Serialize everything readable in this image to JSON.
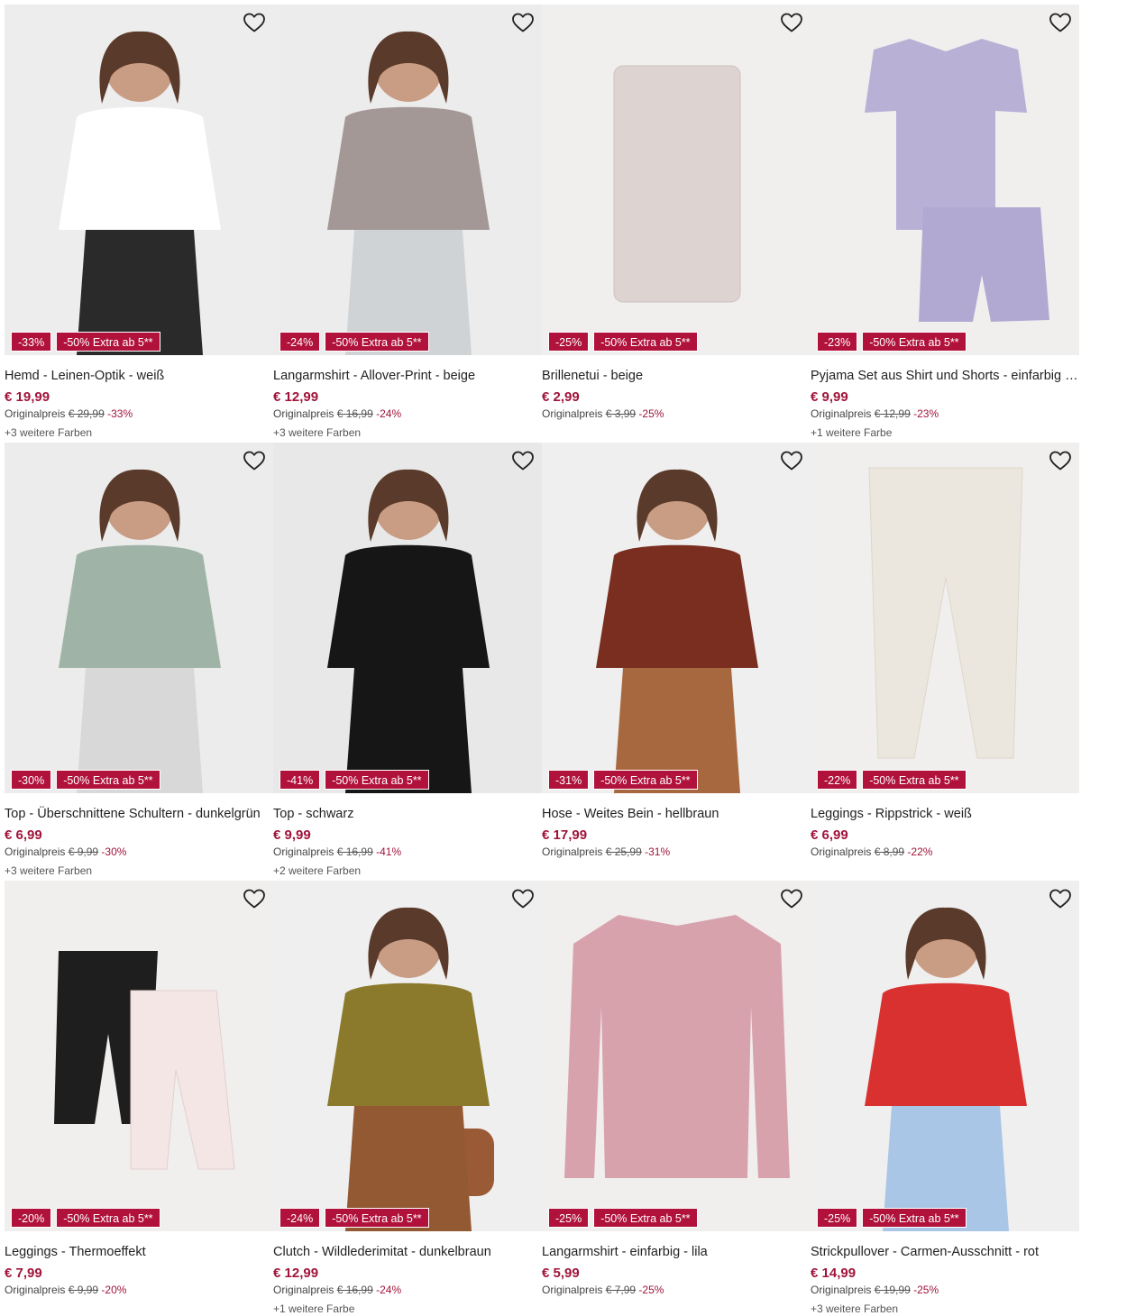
{
  "labels": {
    "originalprice": "Originalpreis"
  },
  "products": [
    {
      "title": "Hemd - Leinen-Optik - weiß",
      "price": "€ 19,99",
      "orig": "€ 29,99",
      "pct": "-33%",
      "badge": "-33%",
      "extra": "-50% Extra ab 5**",
      "colors": "+3 weitere Farben",
      "img": "man-white-shirt",
      "c1": "#ffffff",
      "c2": "#2a2a2a",
      "bg": "#ededed"
    },
    {
      "title": "Langarmshirt - Allover-Print - beige",
      "price": "€ 12,99",
      "orig": "€ 16,99",
      "pct": "-24%",
      "badge": "-24%",
      "extra": "-50% Extra ab 5**",
      "colors": "+3 weitere Farben",
      "img": "woman-print-shirt",
      "c1": "#a39896",
      "c2": "#cfd3d6",
      "bg": "#ececec"
    },
    {
      "title": "Brillenetui - beige",
      "price": "€ 2,99",
      "orig": "€ 3,99",
      "pct": "-25%",
      "badge": "-25%",
      "extra": "-50% Extra ab 5**",
      "colors": "",
      "img": "glasses-case",
      "c1": "#ddd3d0",
      "c2": "#ddd3d0",
      "bg": "#f0efee"
    },
    {
      "title": "Pyjama Set aus Shirt und Shorts - einfarbig - lila",
      "price": "€ 9,99",
      "orig": "€ 12,99",
      "pct": "-23%",
      "badge": "-23%",
      "extra": "-50% Extra ab 5**",
      "colors": "+1 weitere Farbe",
      "img": "pyjama-set",
      "c1": "#b9b0d6",
      "c2": "#b2a9d3",
      "bg": "#f0efee"
    },
    {
      "title": "Top - Überschnittene Schultern - dunkelgrün",
      "price": "€ 6,99",
      "orig": "€ 9,99",
      "pct": "-30%",
      "badge": "-30%",
      "extra": "-50% Extra ab 5**",
      "colors": "+3 weitere Farben",
      "img": "woman-green-top",
      "c1": "#9fb4a6",
      "c2": "#d8d8d8",
      "bg": "#ececec"
    },
    {
      "title": "Top - schwarz",
      "price": "€ 9,99",
      "orig": "€ 16,99",
      "pct": "-41%",
      "badge": "-41%",
      "extra": "-50% Extra ab 5**",
      "colors": "+2 weitere Farben",
      "img": "woman-black-top",
      "c1": "#161616",
      "c2": "#161616",
      "bg": "#e8e8e8"
    },
    {
      "title": "Hose - Weites Bein - hellbraun",
      "price": "€ 17,99",
      "orig": "€ 25,99",
      "pct": "-31%",
      "badge": "-31%",
      "extra": "-50% Extra ab 5**",
      "colors": "",
      "img": "woman-brown-pants",
      "c1": "#7a2e20",
      "c2": "#a8683f",
      "bg": "#efefef"
    },
    {
      "title": "Leggings - Rippstrick - weiß",
      "price": "€ 6,99",
      "orig": "€ 8,99",
      "pct": "-22%",
      "badge": "-22%",
      "extra": "-50% Extra ab 5**",
      "colors": "",
      "img": "knit-leggings",
      "c1": "#ece7de",
      "c2": "#ece7de",
      "bg": "#f0efee"
    },
    {
      "title": "Leggings - Thermoeffekt",
      "price": "€ 7,99",
      "orig": "€ 9,99",
      "pct": "-20%",
      "badge": "-20%",
      "extra": "-50% Extra ab 5**",
      "colors": "",
      "img": "kids-leggings",
      "c1": "#1e1e1e",
      "c2": "#f5e6e6",
      "bg": "#f0efee"
    },
    {
      "title": "Clutch - Wildlederimitat - dunkelbraun",
      "price": "€ 12,99",
      "orig": "€ 16,99",
      "pct": "-24%",
      "badge": "-24%",
      "extra": "-50% Extra ab 5**",
      "colors": "+1 weitere Farbe",
      "img": "woman-clutch",
      "c1": "#8b7a2c",
      "c2": "#9b5a36",
      "bg": "#efefef"
    },
    {
      "title": "Langarmshirt - einfarbig - lila",
      "price": "€ 5,99",
      "orig": "€ 7,99",
      "pct": "-25%",
      "badge": "-25%",
      "extra": "-50% Extra ab 5**",
      "colors": "",
      "img": "pink-longsleeve",
      "c1": "#d8a2ad",
      "c2": "#d8a2ad",
      "bg": "#f0efee"
    },
    {
      "title": "Strickpullover - Carmen-Ausschnitt - rot",
      "price": "€ 14,99",
      "orig": "€ 19,99",
      "pct": "-25%",
      "badge": "-25%",
      "extra": "-50% Extra ab 5**",
      "colors": "+3 weitere Farben",
      "img": "woman-red-sweater",
      "c1": "#d8312f",
      "c2": "#a9c6e6",
      "bg": "#efefef"
    }
  ]
}
